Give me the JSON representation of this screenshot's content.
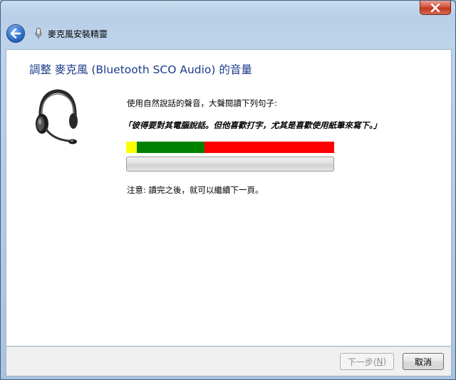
{
  "window": {
    "close_label": "×"
  },
  "nav": {
    "title": "麥克風安裝精靈",
    "back_icon": "back-arrow-icon",
    "app_icon": "microphone-icon"
  },
  "page": {
    "heading": "調整 麥克風 (Bluetooth SCO Audio) 的音量",
    "instruction": "使用自然說話的聲音，大聲閱讀下列句子:",
    "sentence": "「彼得要對其電腦說話。但他喜歡打字，尤其是喜歡使用紙筆來寫下。」",
    "note": "注意: 讀完之後，就可以繼續下一頁。",
    "meter_colors": [
      "#ffff00",
      "#008000",
      "#ff0000"
    ],
    "progress": 0
  },
  "footer": {
    "next_label": "下一步(",
    "next_accel": "N",
    "next_tail": ")",
    "cancel_label": "取消"
  }
}
